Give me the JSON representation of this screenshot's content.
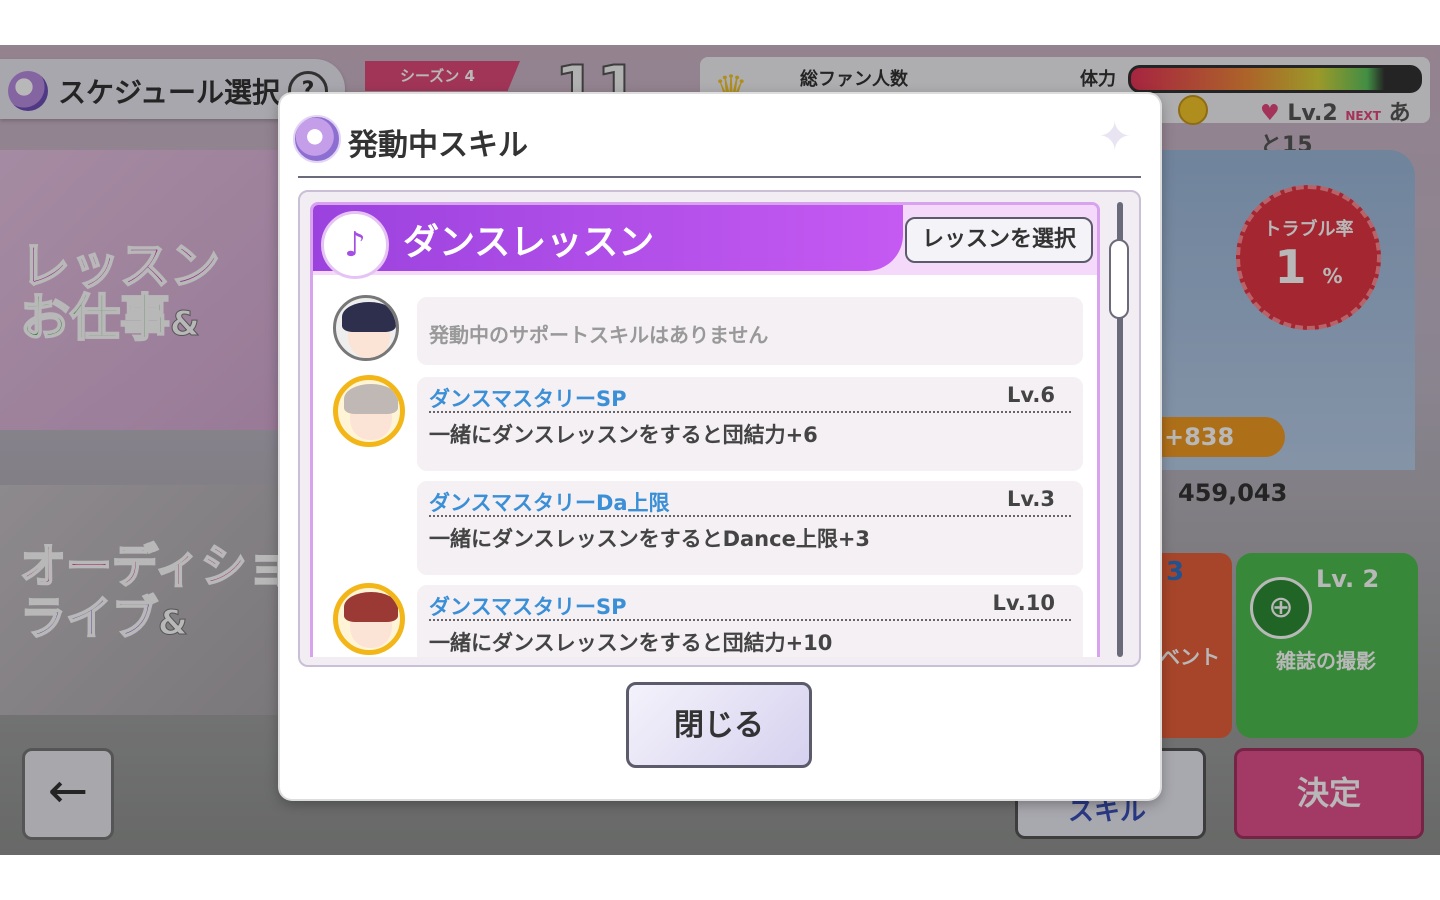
{
  "background": {
    "header_title": "スケジュール選択",
    "help_label": "?",
    "season_label": "シーズン 4",
    "week_value": "11",
    "fans_label": "総ファン人数",
    "stamina_label": "体力",
    "level_label": "Lv.2",
    "next_badge": "NEXT",
    "next_remaining": "あと15",
    "menu_lesson": "レッスン",
    "menu_work": "お仕事",
    "menu_audition": "オーディション",
    "menu_live": "ライブ",
    "amp": "&",
    "back_icon": "←",
    "trouble_label": "トラブル率",
    "trouble_value": "1",
    "trouble_unit": "%",
    "plus_value": "+838",
    "fan_count": "459,043",
    "event_count": "3",
    "event_label": "ベント",
    "magazine_level": "Lv. 2",
    "magazine_label": "雑誌の撮影",
    "skill_label": "スキル",
    "decide_label": "決定"
  },
  "modal": {
    "title": "発動中スキル",
    "lesson": {
      "name": "ダンスレッスン",
      "select_button": "レッスンを選択"
    },
    "rows": [
      {
        "avatar": "neutral",
        "none_text": "発動中のサポートスキルはありません"
      },
      {
        "avatar": "gold",
        "name": "ダンスマスタリーSP",
        "level": "Lv.6",
        "desc": "一緒にダンスレッスンをすると団結力+6"
      },
      {
        "avatar": "none",
        "name": "ダンスマスタリーDa上限",
        "level": "Lv.3",
        "desc": "一緒にダンスレッスンをするとDance上限+3"
      },
      {
        "avatar": "gold",
        "name": "ダンスマスタリーSP",
        "level": "Lv.10",
        "desc": "一緒にダンスレッスンをすると団結力+10"
      }
    ],
    "close_button": "閉じる"
  },
  "colors": {
    "lesson_purple": "#a44ee3",
    "skill_name_blue": "#3a8fd6",
    "gold_frame": "#f2b619"
  }
}
